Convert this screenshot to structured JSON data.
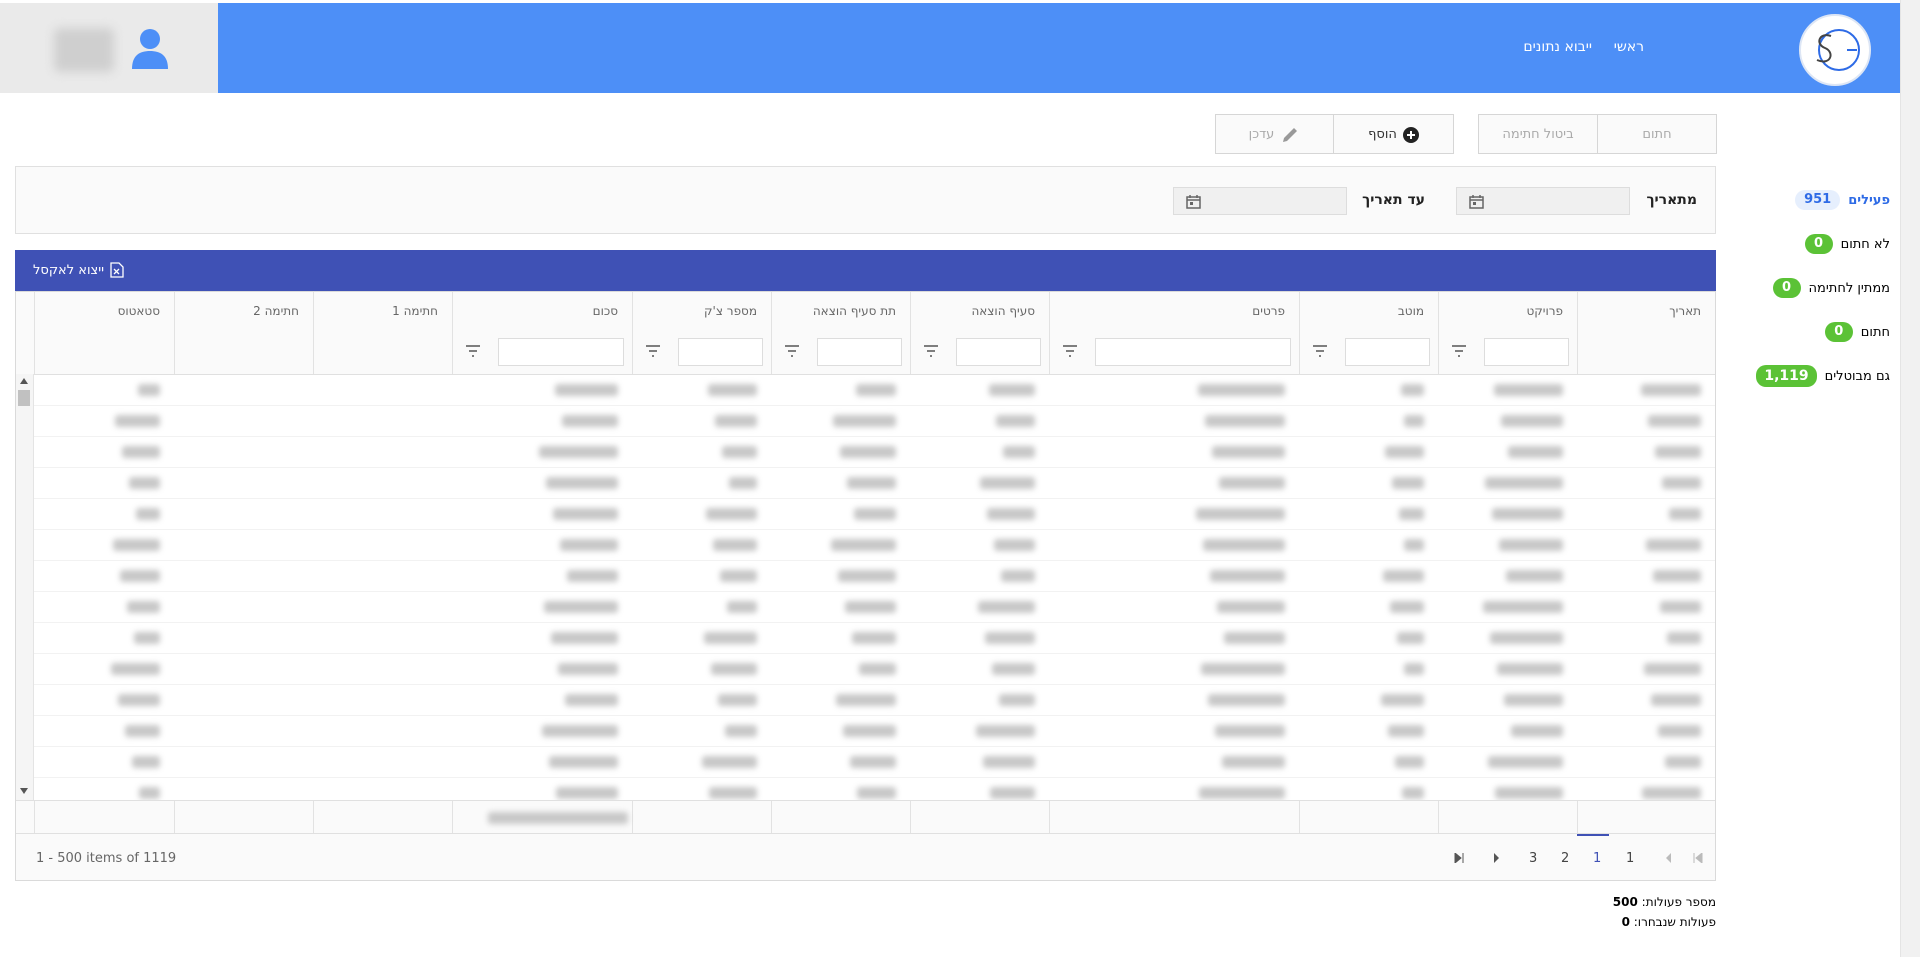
{
  "nav": {
    "home": "ראשי",
    "import": "ייבוא נתונים"
  },
  "sidebar": {
    "items": [
      {
        "label": "פעילים",
        "count": "951"
      },
      {
        "label": "לא חתום",
        "count": "0"
      },
      {
        "label": "ממתין לחתימה",
        "count": "0"
      },
      {
        "label": "חתום",
        "count": "0"
      },
      {
        "label": "גם מבוטלים",
        "count": "1,119"
      }
    ]
  },
  "actions": {
    "sign": "חתום",
    "cancel_sign": "ביטול חתימה",
    "add": "הוסף",
    "edit": "עדכן"
  },
  "filters": {
    "from_date": "מתאריך",
    "to_date": "עד תאריך"
  },
  "export": {
    "label": "ייצוא לאקסל"
  },
  "grid": {
    "columns": [
      "תאריך",
      "פרויקט",
      "מוטב",
      "פרטים",
      "סעיף הוצאה",
      "תת סעיף הוצאה",
      "מספר צ'ק",
      "סכום",
      "חתימה 1",
      "חתימה 2",
      "סטאטוס"
    ]
  },
  "pager": {
    "pages": [
      "1",
      "1",
      "2",
      "3"
    ],
    "items_info": "1 - 500 items of 1119"
  },
  "summary": {
    "actions_label": "מספר פעולות:",
    "actions_count": "500",
    "selected_label": "פעולות שנבחרו:",
    "selected_count": "0"
  },
  "colors": {
    "topbar": "#4d8ff7",
    "header_bar": "#3f51b5",
    "pill_green": "#5bc236"
  }
}
